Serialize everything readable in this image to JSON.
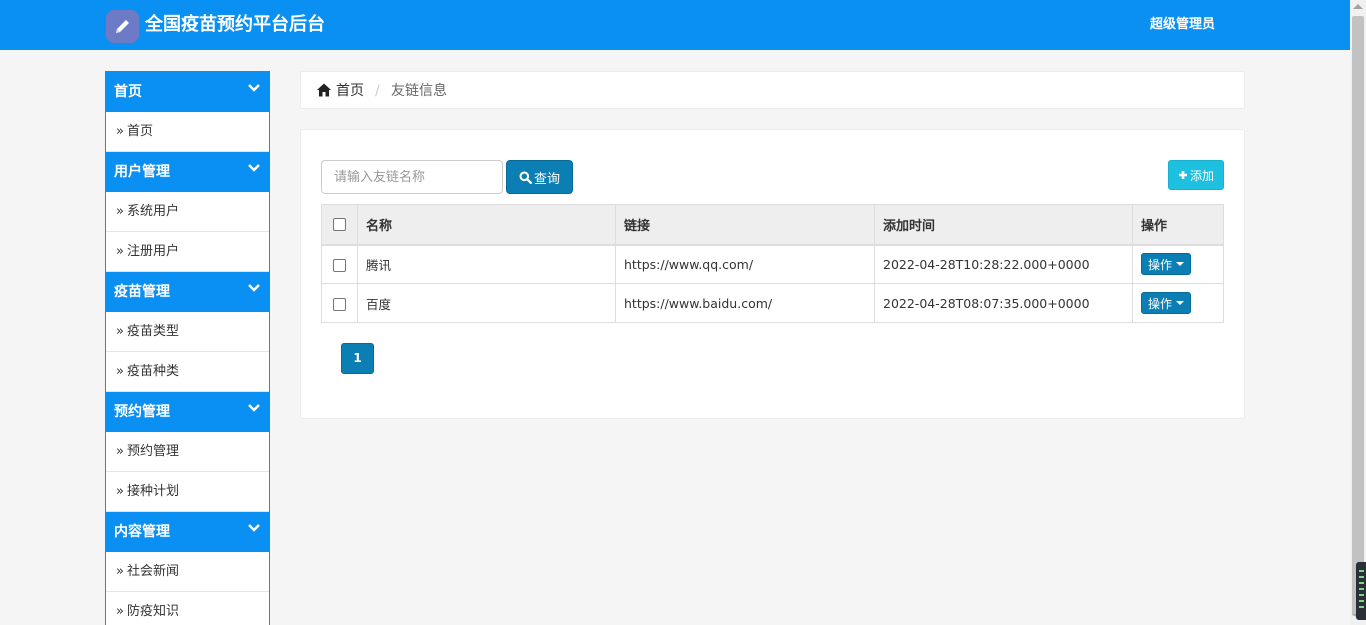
{
  "header": {
    "title": "全国疫苗预约平台后台",
    "user": "超级管理员"
  },
  "sidebar": {
    "groups": [
      {
        "label": "首页",
        "items": [
          {
            "label": "首页"
          }
        ]
      },
      {
        "label": "用户管理",
        "items": [
          {
            "label": "系统用户"
          },
          {
            "label": "注册用户"
          }
        ]
      },
      {
        "label": "疫苗管理",
        "items": [
          {
            "label": "疫苗类型"
          },
          {
            "label": "疫苗种类"
          }
        ]
      },
      {
        "label": "预约管理",
        "items": [
          {
            "label": "预约管理"
          },
          {
            "label": "接种计划"
          }
        ]
      },
      {
        "label": "内容管理",
        "items": [
          {
            "label": "社会新闻"
          },
          {
            "label": "防疫知识"
          }
        ]
      }
    ]
  },
  "breadcrumb": {
    "home": "首页",
    "separator": "/",
    "current": "友链信息"
  },
  "toolbar": {
    "search_placeholder": "请输入友链名称",
    "search_label": "查询",
    "add_label": "添加"
  },
  "table": {
    "columns": [
      "名称",
      "链接",
      "添加时间",
      "操作"
    ],
    "rows": [
      {
        "name": "腾讯",
        "link": "https://www.qq.com/",
        "time": "2022-04-28T10:28:22.000+0000",
        "action": "操作"
      },
      {
        "name": "百度",
        "link": "https://www.baidu.com/",
        "time": "2022-04-28T08:07:35.000+0000",
        "action": "操作"
      }
    ]
  },
  "pagination": {
    "current_page": "1"
  },
  "colors": {
    "header_bg": "#0a8ff2",
    "primary_button": "#0b7fb4",
    "add_button": "#1ec0e0"
  }
}
